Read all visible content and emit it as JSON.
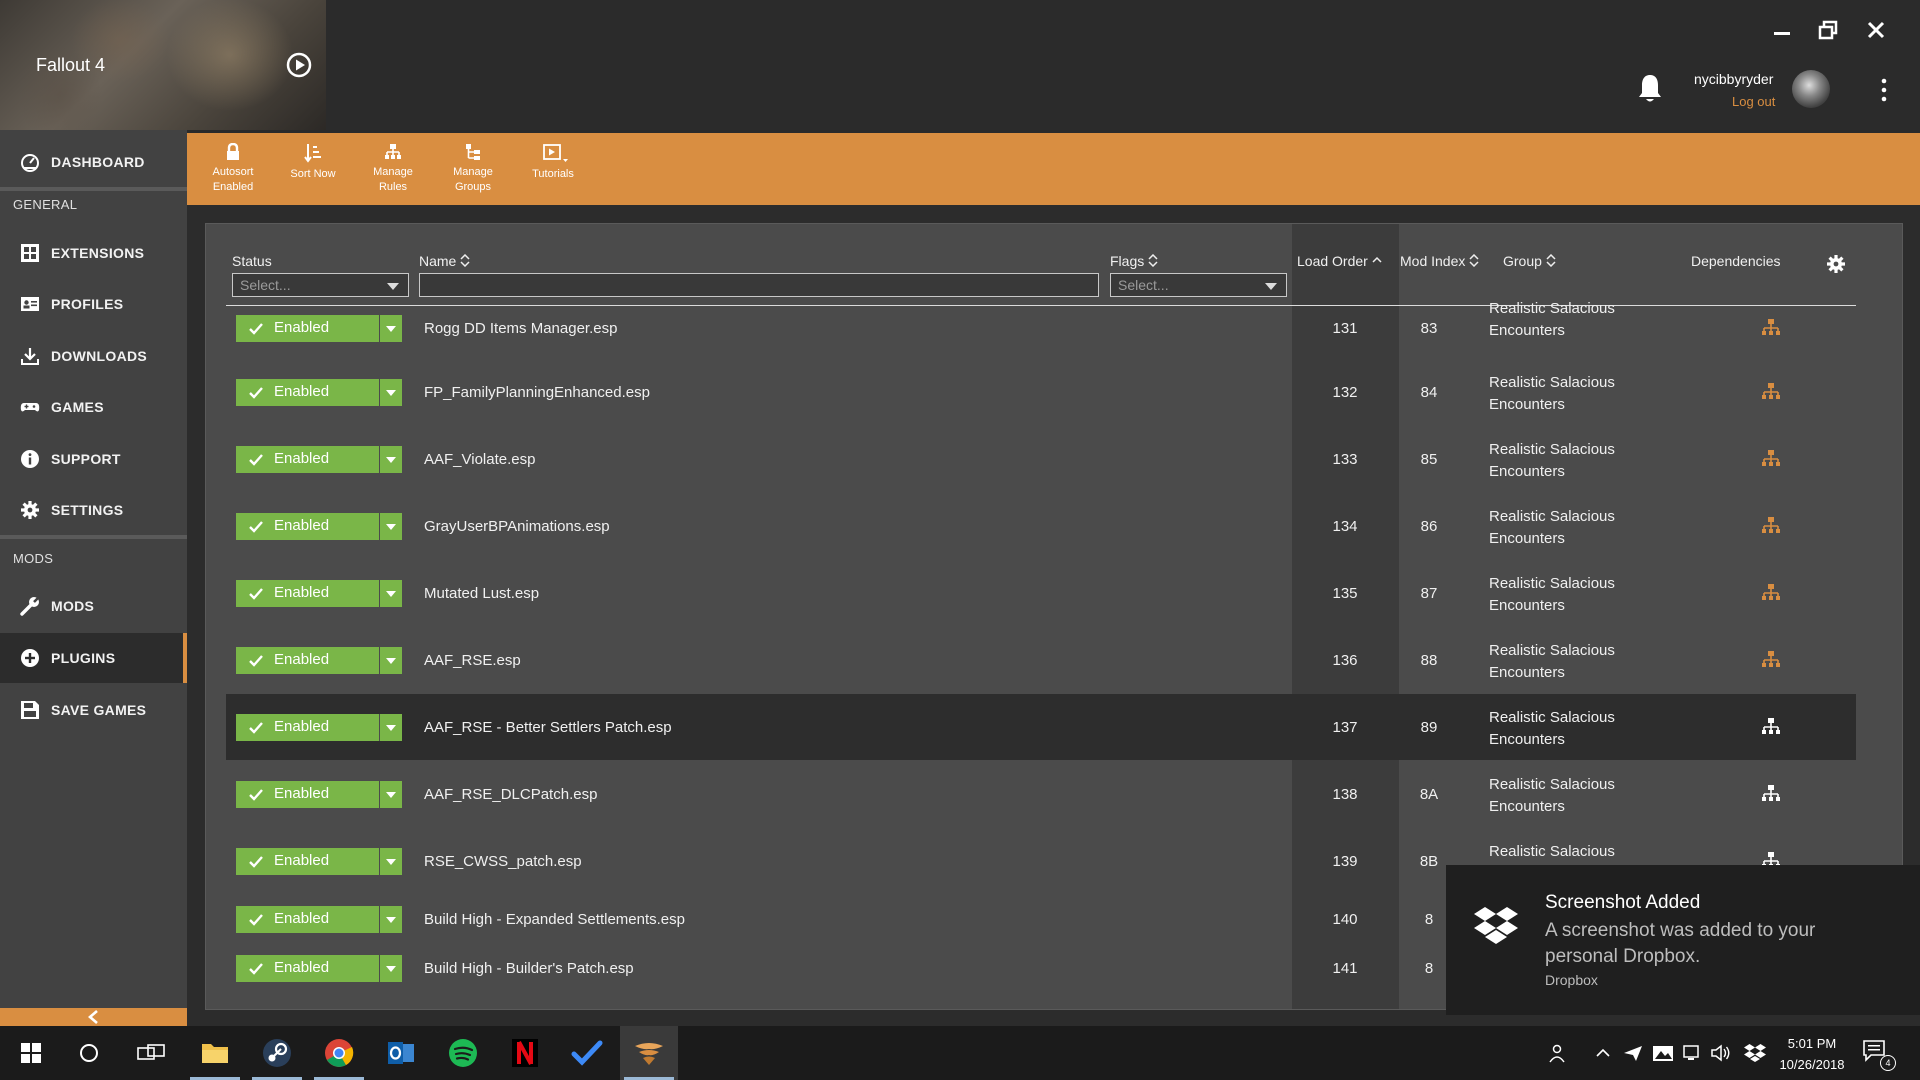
{
  "header": {
    "game_title": "Fallout 4",
    "username": "nycibbyryder",
    "logout_label": "Log out"
  },
  "sidebar": {
    "sections": [
      "GENERAL",
      "MODS"
    ],
    "items": [
      {
        "label": "DASHBOARD",
        "icon": "dashboard-icon"
      },
      {
        "label": "EXTENSIONS",
        "icon": "extensions-icon"
      },
      {
        "label": "PROFILES",
        "icon": "profiles-icon"
      },
      {
        "label": "DOWNLOADS",
        "icon": "download-icon"
      },
      {
        "label": "GAMES",
        "icon": "gamepad-icon"
      },
      {
        "label": "SUPPORT",
        "icon": "info-icon"
      },
      {
        "label": "SETTINGS",
        "icon": "gear-icon"
      },
      {
        "label": "MODS",
        "icon": "wrench-icon"
      },
      {
        "label": "PLUGINS",
        "icon": "plus-circle-icon"
      },
      {
        "label": "SAVE GAMES",
        "icon": "floppy-icon"
      }
    ]
  },
  "toolbar": {
    "autosort": {
      "line1": "Autosort",
      "line2": "Enabled"
    },
    "sort_now": "Sort Now",
    "manage_rules": {
      "line1": "Manage",
      "line2": "Rules"
    },
    "manage_groups": {
      "line1": "Manage",
      "line2": "Groups"
    },
    "tutorials": "Tutorials"
  },
  "table": {
    "columns": {
      "status": "Status",
      "name": "Name",
      "flags": "Flags",
      "load_order": "Load Order",
      "mod_index": "Mod Index",
      "group": "Group",
      "dependencies": "Dependencies"
    },
    "filters": {
      "status_placeholder": "Select...",
      "name_value": "",
      "flags_placeholder": "Select..."
    },
    "status_label": "Enabled",
    "rows": [
      {
        "name": "Rogg DD Items Manager.esp",
        "load_order": "131",
        "mod_index": "83",
        "group1": "Realistic Salacious",
        "group2": "Encounters"
      },
      {
        "name": "FP_FamilyPlanningEnhanced.esp",
        "load_order": "132",
        "mod_index": "84",
        "group1": "Realistic Salacious",
        "group2": "Encounters"
      },
      {
        "name": "AAF_Violate.esp",
        "load_order": "133",
        "mod_index": "85",
        "group1": "Realistic Salacious",
        "group2": "Encounters"
      },
      {
        "name": "GrayUserBPAnimations.esp",
        "load_order": "134",
        "mod_index": "86",
        "group1": "Realistic Salacious",
        "group2": "Encounters"
      },
      {
        "name": "Mutated Lust.esp",
        "load_order": "135",
        "mod_index": "87",
        "group1": "Realistic Salacious",
        "group2": "Encounters"
      },
      {
        "name": "AAF_RSE.esp",
        "load_order": "136",
        "mod_index": "88",
        "group1": "Realistic Salacious",
        "group2": "Encounters"
      },
      {
        "name": "AAF_RSE - Better Settlers Patch.esp",
        "load_order": "137",
        "mod_index": "89",
        "group1": "Realistic Salacious",
        "group2": "Encounters"
      },
      {
        "name": "AAF_RSE_DLCPatch.esp",
        "load_order": "138",
        "mod_index": "8A",
        "group1": "Realistic Salacious",
        "group2": "Encounters"
      },
      {
        "name": "RSE_CWSS_patch.esp",
        "load_order": "139",
        "mod_index": "8B",
        "group1": "Realistic Salacious",
        "group2": ""
      },
      {
        "name": "Build High - Expanded Settlements.esp",
        "load_order": "140",
        "mod_index": "8",
        "group1": "",
        "group2": ""
      },
      {
        "name": "Build High - Builder's Patch.esp",
        "load_order": "141",
        "mod_index": "8",
        "group1": "",
        "group2": ""
      }
    ]
  },
  "toast": {
    "title": "Screenshot Added",
    "body": "A screenshot was added to your personal Dropbox.",
    "source": "Dropbox"
  },
  "taskbar": {
    "time": "5:01 PM",
    "date": "10/26/2018",
    "notification_count": "4"
  },
  "colors": {
    "accent": "#d98e41",
    "enabled_green": "#7ab648",
    "sidebar_bg": "#424242",
    "panel_bg": "#4b4b4b"
  }
}
